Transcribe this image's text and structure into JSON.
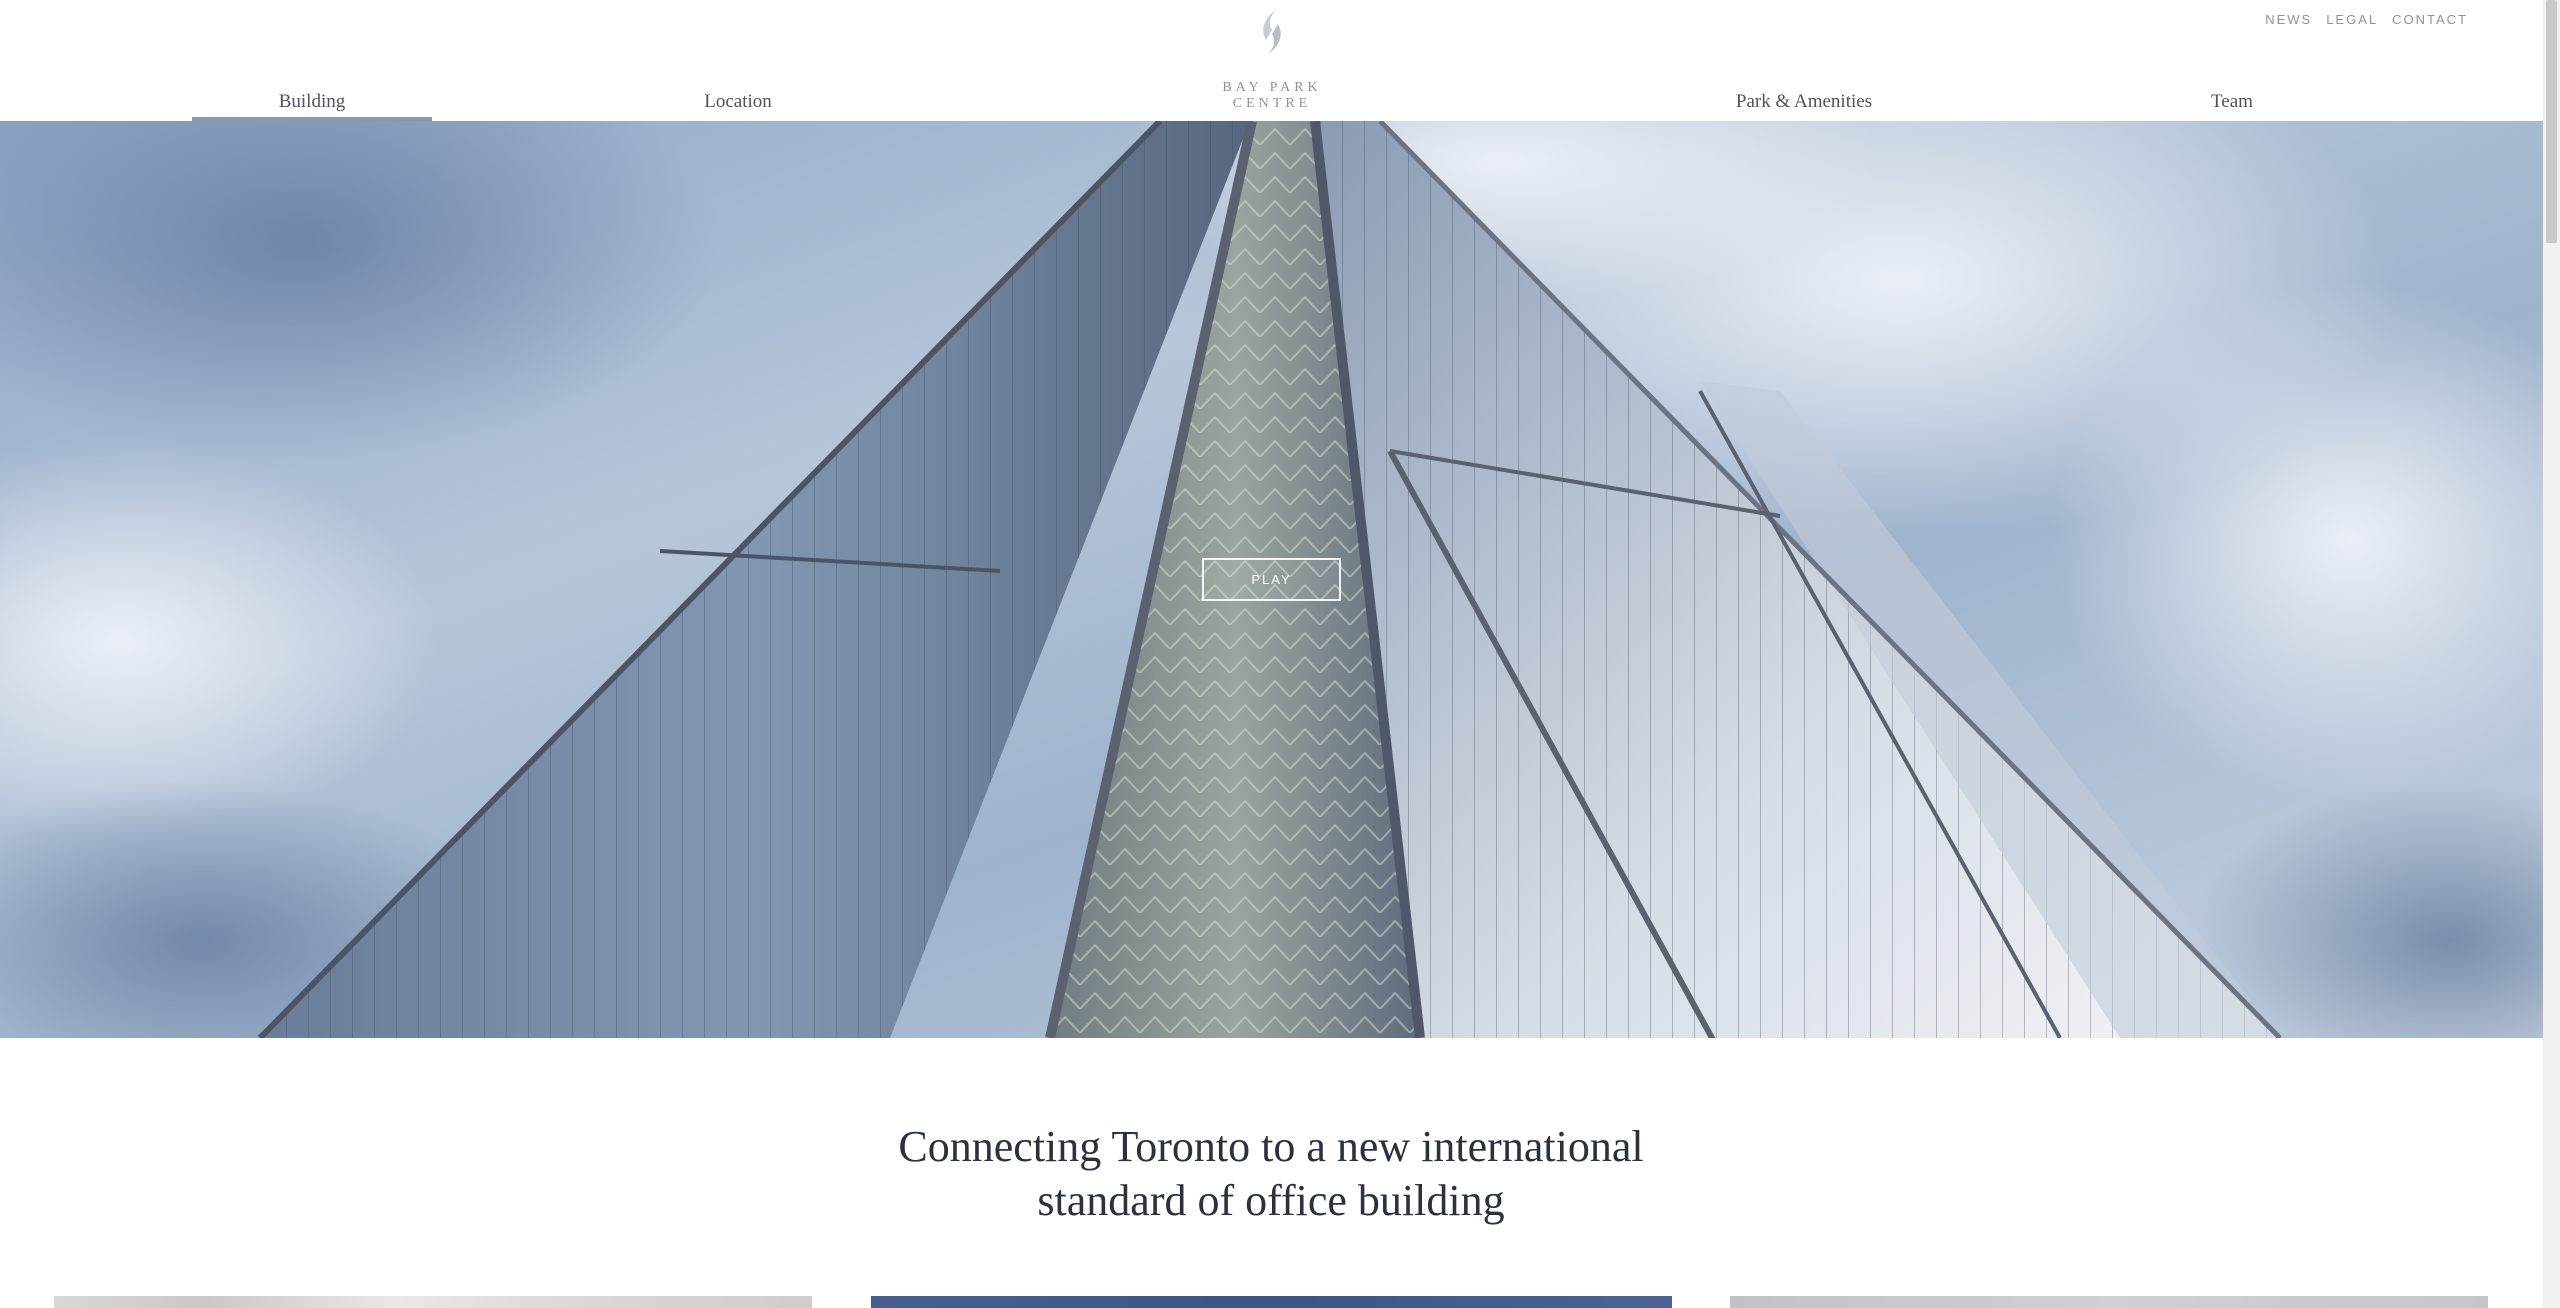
{
  "header": {
    "logo_text": "BAY PARK CENTRE",
    "utility_nav": [
      {
        "label": "NEWS"
      },
      {
        "label": "LEGAL"
      },
      {
        "label": "CONTACT"
      }
    ],
    "main_nav": [
      {
        "label": "Building",
        "active": true
      },
      {
        "label": "Location",
        "active": false
      },
      {
        "label": "Park & Amenities",
        "active": false
      },
      {
        "label": "Team",
        "active": false
      }
    ]
  },
  "hero": {
    "play_label": "PLAY"
  },
  "intro": {
    "heading_line1": "Connecting Toronto to a new international",
    "heading_line2": "standard of office building"
  },
  "colors": {
    "text_dark": "#2c3140",
    "nav_text": "#4d525c",
    "muted": "#8d929a",
    "active_underline": "#8e98a3",
    "sky": "#9fb4cf",
    "glass": "#5d6f88"
  },
  "icons": {
    "logo_mark": "leaf-logo-icon"
  }
}
